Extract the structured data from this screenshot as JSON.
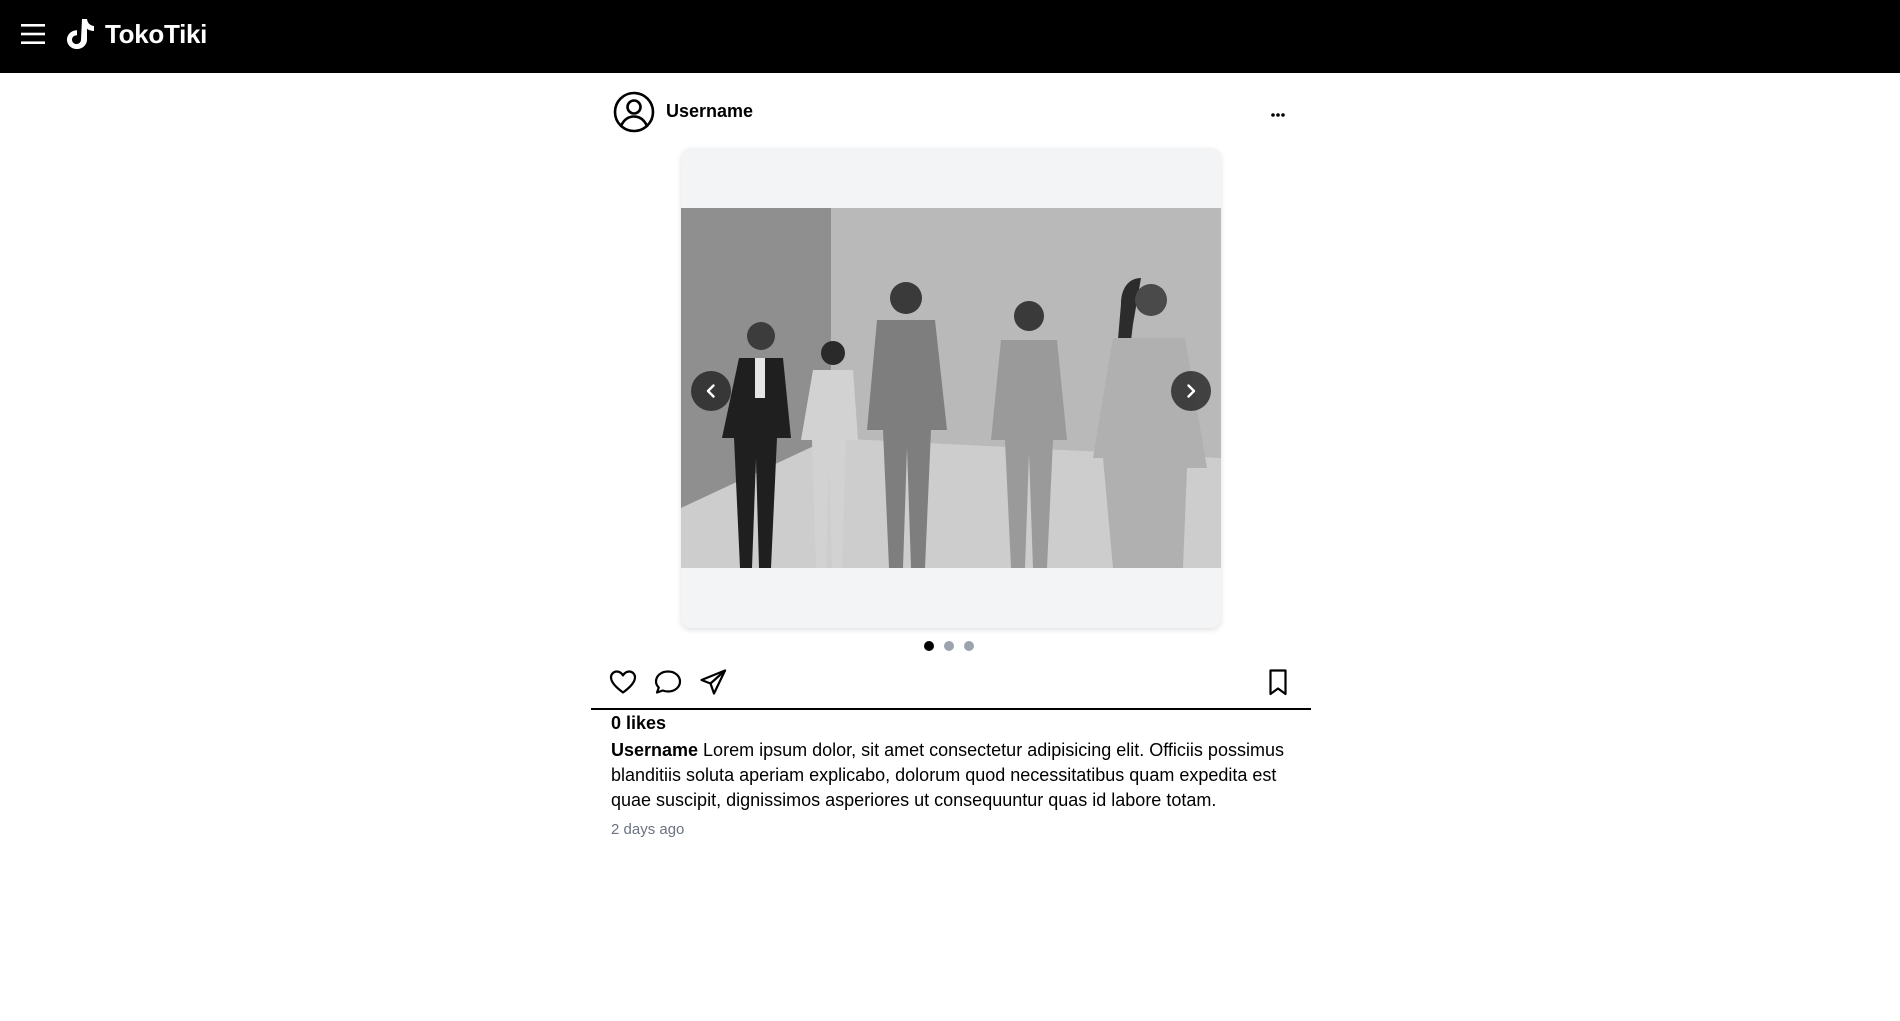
{
  "app": {
    "name": "TokoTiki"
  },
  "post": {
    "username": "Username",
    "more_label": "...",
    "slides": [
      {
        "icon": "image-slide"
      },
      {
        "icon": "image-slide"
      },
      {
        "icon": "image-slide"
      }
    ],
    "active_slide": 1,
    "likes_text": "0 likes",
    "caption_user": "Username",
    "caption_text": " Lorem ipsum dolor, sit amet consectetur adipisicing elit. Officiis possimus blanditiis soluta aperiam explicabo, dolorum quod necessitatibus quam expedita est quae suscipit, dignissimos asperiores ut consequuntur quas id labore totam.",
    "timestamp": "2 days ago"
  },
  "icons": {
    "menu": "hamburger-icon",
    "logo": "tiktok-logo-icon",
    "avatar": "user-circle-icon",
    "more": "more-icon",
    "prev": "chevron-left-icon",
    "next": "chevron-right-icon",
    "like": "heart-icon",
    "comment": "comment-icon",
    "share": "paper-plane-icon",
    "save": "bookmark-icon"
  },
  "colors": {
    "topbar": "#000000",
    "carousel_bg": "#f3f4f6",
    "dot_inactive": "#9ca3af",
    "dot_active": "#000000",
    "timestamp": "#6b7280"
  }
}
